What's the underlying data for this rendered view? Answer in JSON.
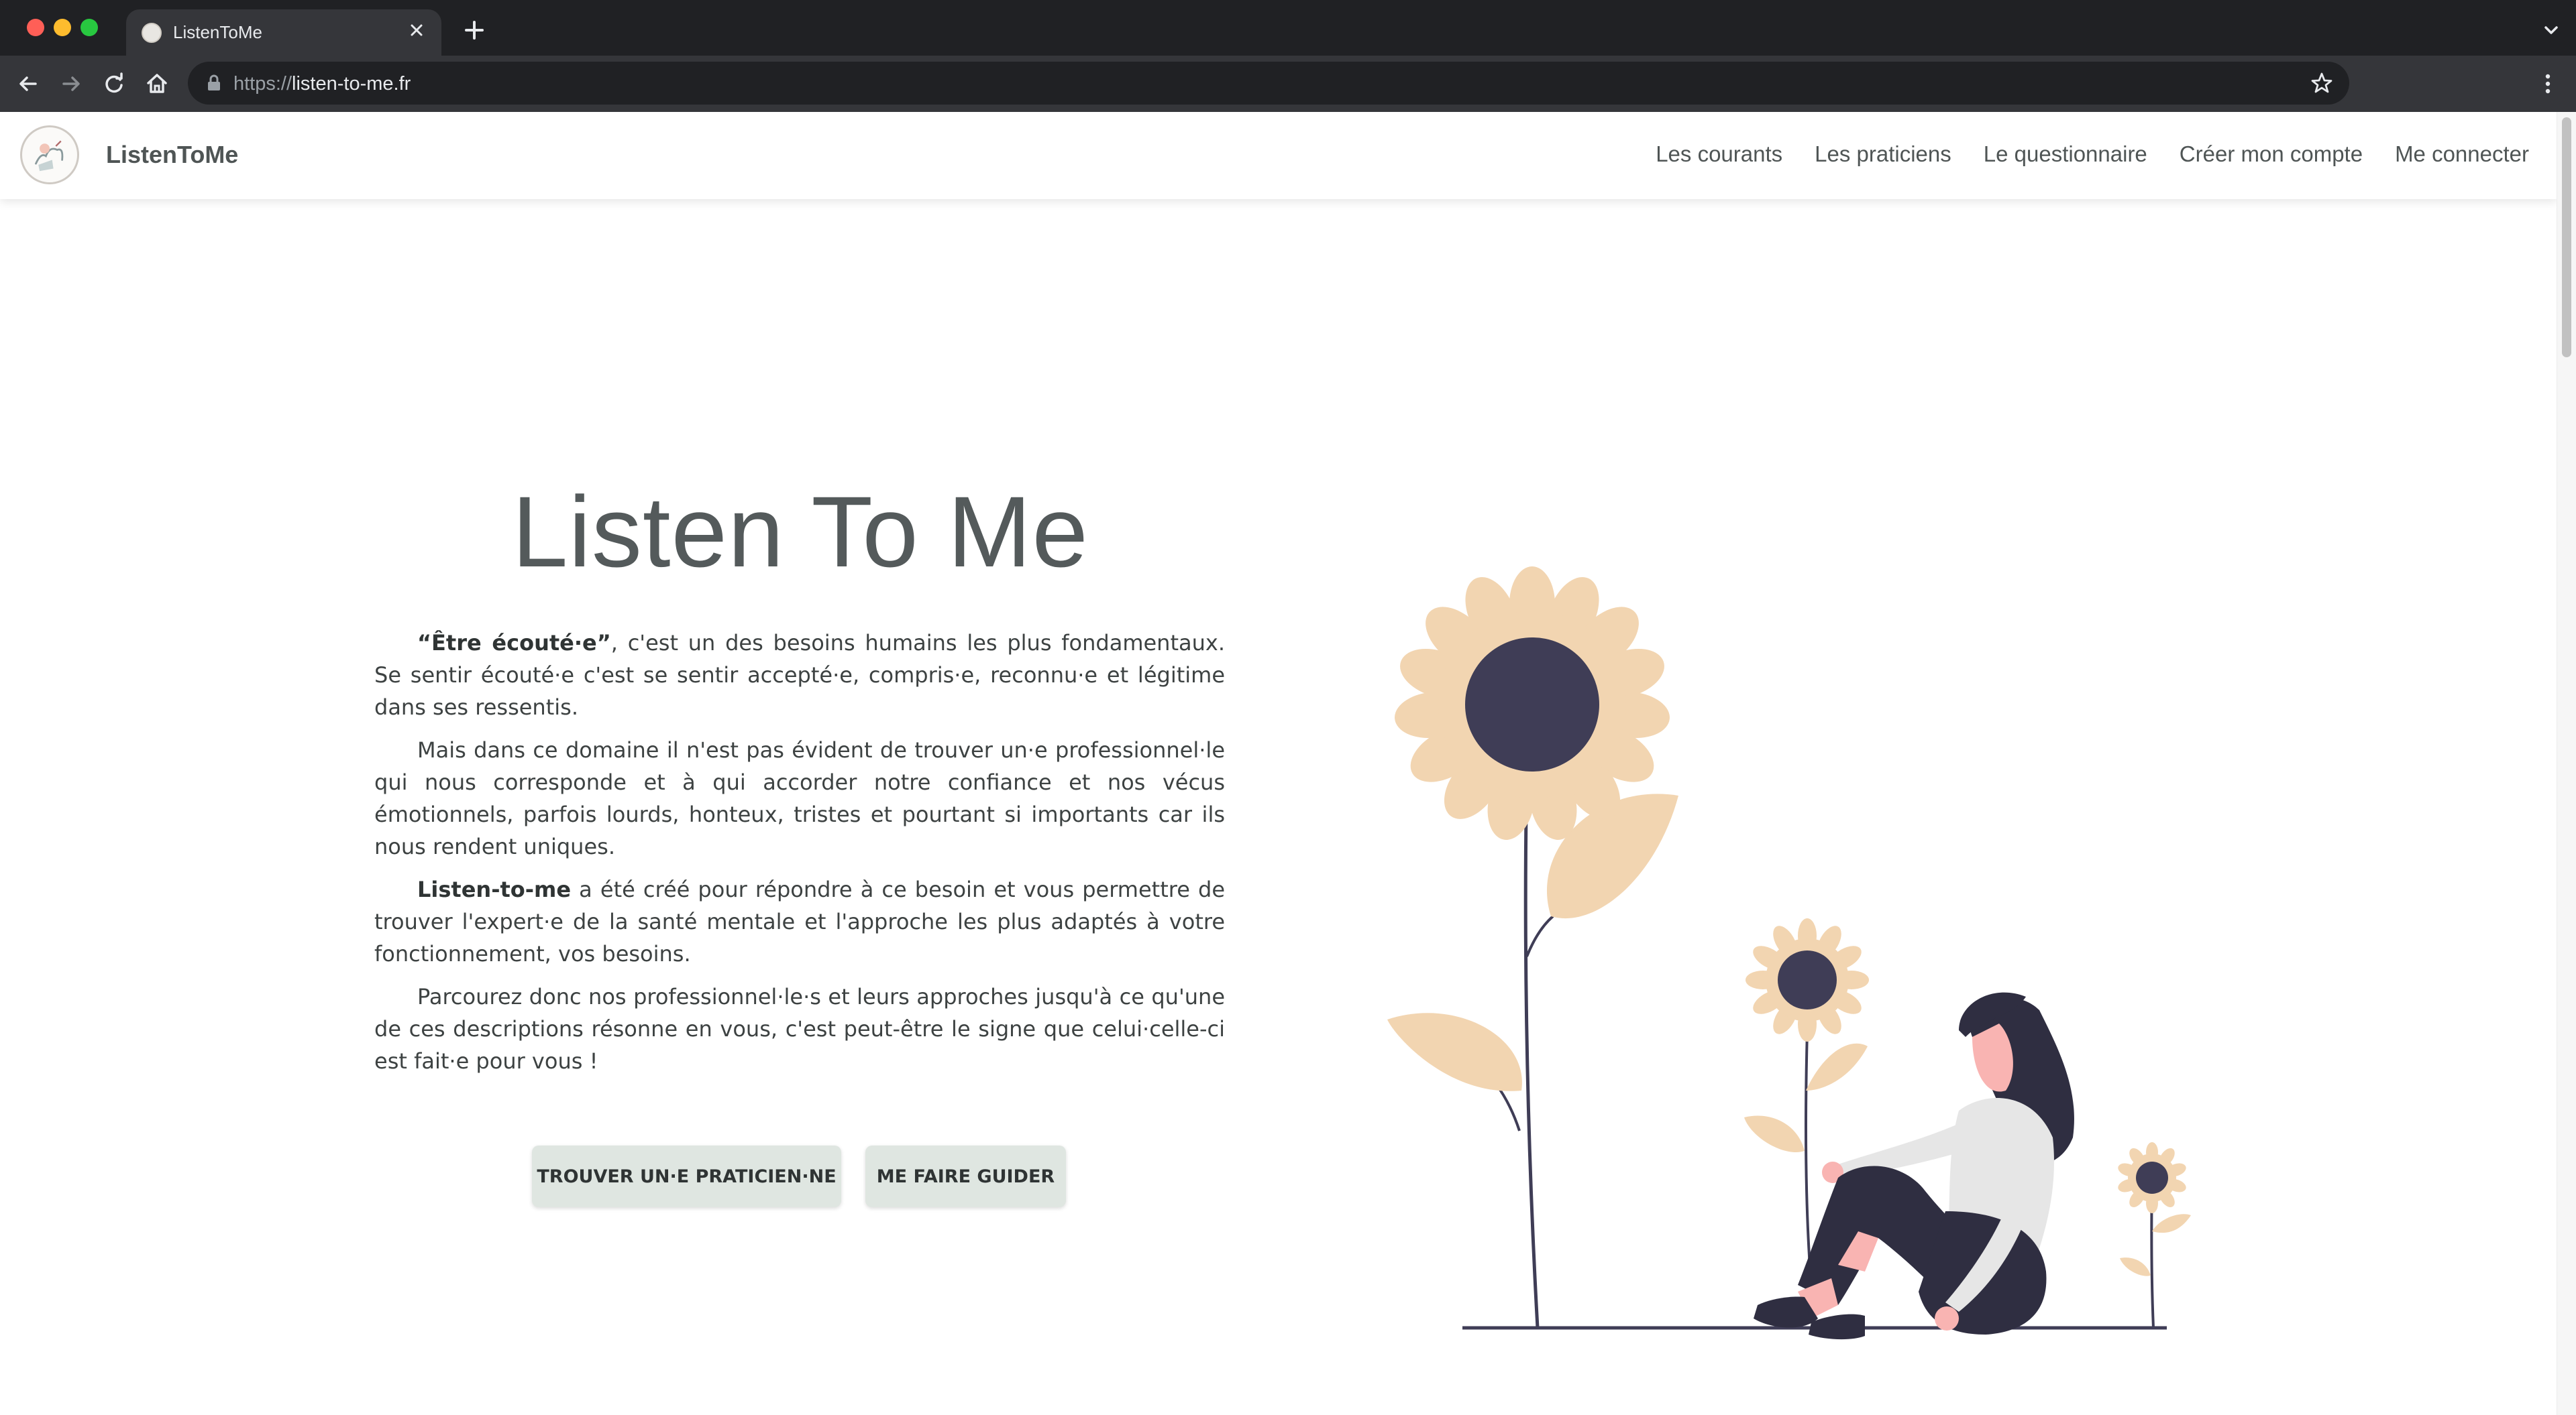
{
  "browser": {
    "tab_title": "ListenToMe",
    "url_scheme": "https://",
    "url_host": "listen-to-me.fr"
  },
  "site": {
    "brand": "ListenToMe",
    "nav": [
      {
        "label": "Les courants"
      },
      {
        "label": "Les praticiens"
      },
      {
        "label": "Le questionnaire"
      },
      {
        "label": "Créer mon compte"
      },
      {
        "label": "Me connecter"
      }
    ]
  },
  "hero": {
    "title": "Listen To Me",
    "p1_bold": "“Être écouté·e”",
    "p1_rest": ", c'est un des besoins humains les plus fondamentaux. Se sentir écouté·e c'est se sentir accepté·e, compris·e, reconnu·e et légitime dans ses ressentis.",
    "p2": "Mais dans ce domaine il n'est pas évident de trouver un·e professionnel·le qui nous corresponde et à qui accorder notre confiance et nos vécus émotionnels, parfois lourds, honteux, tristes et pourtant si importants car ils nous rendent uniques.",
    "p3_bold": "Listen-to-me",
    "p3_rest": " a été créé pour répondre à ce besoin et vous permettre de trouver l'expert·e de la santé mentale et l'approche les plus adaptés à votre fonctionnement, vos besoins.",
    "p4": "Parcourez donc nos professionnel·le·s et leurs approches jusqu'à ce qu'une de ces descriptions résonne en vous, c'est peut-être le signe que celui·celle-ci est fait·e pour vous !",
    "cta_primary": "TROUVER UN·E PRATICIEN·NE",
    "cta_secondary": "ME FAIRE GUIDER"
  },
  "colors": {
    "petal": "#f2d5b1",
    "flower_center": "#3f3d56",
    "skin": "#f9b4b2",
    "shirt": "#e6e6e6",
    "pants": "#2f2e41",
    "button_bg": "#dfe6e1",
    "text": "#545a5b"
  }
}
